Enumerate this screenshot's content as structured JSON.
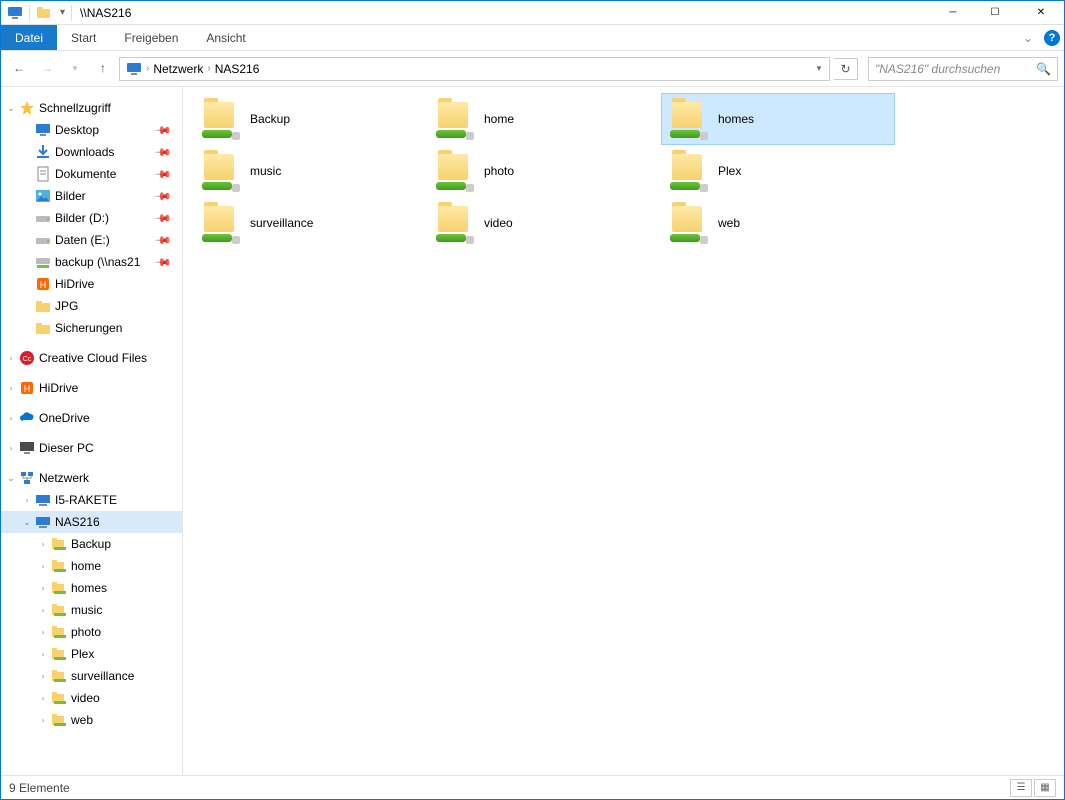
{
  "title": "\\\\NAS216",
  "ribbon": {
    "file": "Datei",
    "tabs": [
      "Start",
      "Freigeben",
      "Ansicht"
    ]
  },
  "breadcrumbs": [
    "Netzwerk",
    "NAS216"
  ],
  "search_placeholder": "\"NAS216\" durchsuchen",
  "status": "9 Elemente",
  "items": [
    {
      "name": "Backup"
    },
    {
      "name": "home"
    },
    {
      "name": "homes",
      "selected": true
    },
    {
      "name": "music"
    },
    {
      "name": "photo"
    },
    {
      "name": "Plex"
    },
    {
      "name": "surveillance"
    },
    {
      "name": "video"
    },
    {
      "name": "web"
    }
  ],
  "tree": [
    {
      "ind": 0,
      "exp": "v",
      "icon": "star",
      "label": "Schnellzugriff"
    },
    {
      "ind": 1,
      "exp": "",
      "icon": "desktop",
      "label": "Desktop",
      "pin": true
    },
    {
      "ind": 1,
      "exp": "",
      "icon": "download",
      "label": "Downloads",
      "pin": true
    },
    {
      "ind": 1,
      "exp": "",
      "icon": "doc",
      "label": "Dokumente",
      "pin": true
    },
    {
      "ind": 1,
      "exp": "",
      "icon": "pic",
      "label": "Bilder",
      "pin": true
    },
    {
      "ind": 1,
      "exp": "",
      "icon": "drive",
      "label": "Bilder (D:)",
      "pin": true
    },
    {
      "ind": 1,
      "exp": "",
      "icon": "drive",
      "label": "Daten (E:)",
      "pin": true
    },
    {
      "ind": 1,
      "exp": "",
      "icon": "netdrive",
      "label": "backup (\\\\nas21",
      "pin": true
    },
    {
      "ind": 1,
      "exp": "",
      "icon": "hidrive",
      "label": "HiDrive"
    },
    {
      "ind": 1,
      "exp": "",
      "icon": "folder",
      "label": "JPG"
    },
    {
      "ind": 1,
      "exp": "",
      "icon": "folder",
      "label": "Sicherungen"
    },
    {
      "ind": 0,
      "spacer": true
    },
    {
      "ind": 0,
      "exp": ">",
      "icon": "cc",
      "label": "Creative Cloud Files"
    },
    {
      "ind": 0,
      "spacer": true
    },
    {
      "ind": 0,
      "exp": ">",
      "icon": "hidrive",
      "label": "HiDrive"
    },
    {
      "ind": 0,
      "spacer": true
    },
    {
      "ind": 0,
      "exp": ">",
      "icon": "onedrive",
      "label": "OneDrive"
    },
    {
      "ind": 0,
      "spacer": true
    },
    {
      "ind": 0,
      "exp": ">",
      "icon": "pc",
      "label": "Dieser PC"
    },
    {
      "ind": 0,
      "spacer": true
    },
    {
      "ind": 0,
      "exp": "v",
      "icon": "network",
      "label": "Netzwerk"
    },
    {
      "ind": 1,
      "exp": ">",
      "icon": "computer",
      "label": "I5-RAKETE"
    },
    {
      "ind": 1,
      "exp": "v",
      "icon": "computer",
      "label": "NAS216",
      "selected": true
    },
    {
      "ind": 2,
      "exp": ">",
      "icon": "share",
      "label": "Backup"
    },
    {
      "ind": 2,
      "exp": ">",
      "icon": "share",
      "label": "home"
    },
    {
      "ind": 2,
      "exp": ">",
      "icon": "share",
      "label": "homes"
    },
    {
      "ind": 2,
      "exp": ">",
      "icon": "share",
      "label": "music"
    },
    {
      "ind": 2,
      "exp": ">",
      "icon": "share",
      "label": "photo"
    },
    {
      "ind": 2,
      "exp": ">",
      "icon": "share",
      "label": "Plex"
    },
    {
      "ind": 2,
      "exp": ">",
      "icon": "share",
      "label": "surveillance"
    },
    {
      "ind": 2,
      "exp": ">",
      "icon": "share",
      "label": "video"
    },
    {
      "ind": 2,
      "exp": ">",
      "icon": "share",
      "label": "web"
    }
  ]
}
